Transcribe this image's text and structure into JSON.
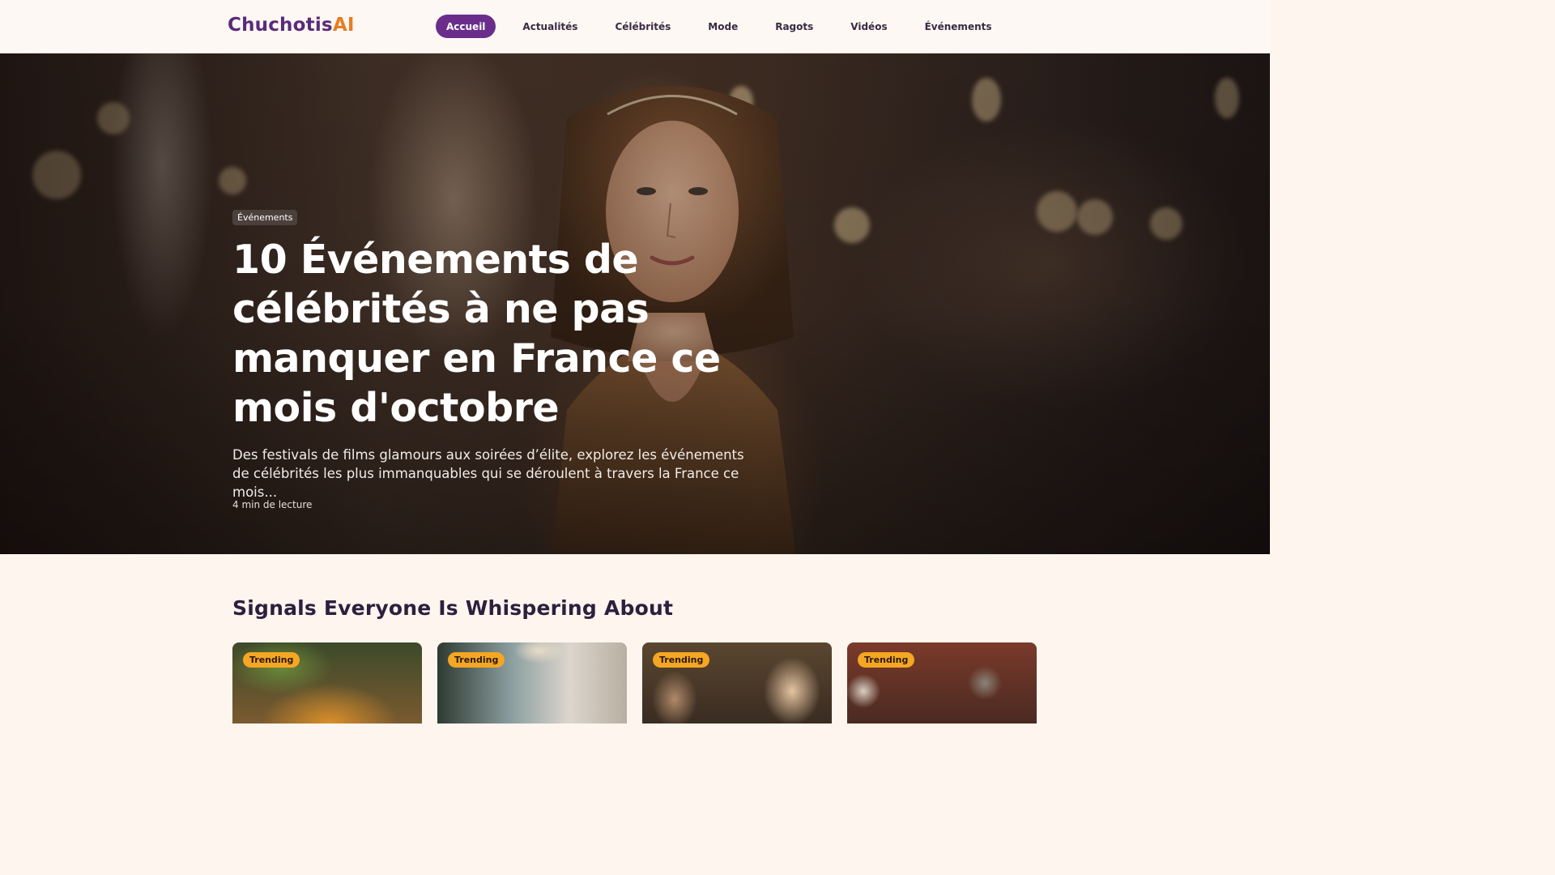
{
  "header": {
    "logo_part1": "Chuchotis",
    "logo_part2": "AI",
    "nav": [
      {
        "label": "Accueil",
        "active": true
      },
      {
        "label": "Actualités"
      },
      {
        "label": "Célébrités"
      },
      {
        "label": "Mode"
      },
      {
        "label": "Ragots"
      },
      {
        "label": "Vidéos"
      },
      {
        "label": "Événements"
      }
    ]
  },
  "hero": {
    "category": "Événements",
    "title": "10 Événements de célébrités à ne pas manquer en France ce mois d'octobre",
    "description": "Des festivals de films glamours aux soirées d’élite, explorez les événements de célébrités les plus immanquables qui se déroulent à travers la France ce mois...",
    "read_time": "4 min de lecture"
  },
  "section": {
    "title": "Signals Everyone Is Whispering About",
    "cards": [
      {
        "badge": "Trending",
        "image": "food-platter-image"
      },
      {
        "badge": "Trending",
        "image": "modern-interior-image"
      },
      {
        "badge": "Trending",
        "image": "gala-guests-image"
      },
      {
        "badge": "Trending",
        "image": "winter-street-people-image"
      }
    ]
  },
  "colors": {
    "brand_purple": "#6a2d8c",
    "brand_orange": "#e67e22",
    "badge_yellow": "#f5a623",
    "page_bg": "#fdf5ee"
  }
}
